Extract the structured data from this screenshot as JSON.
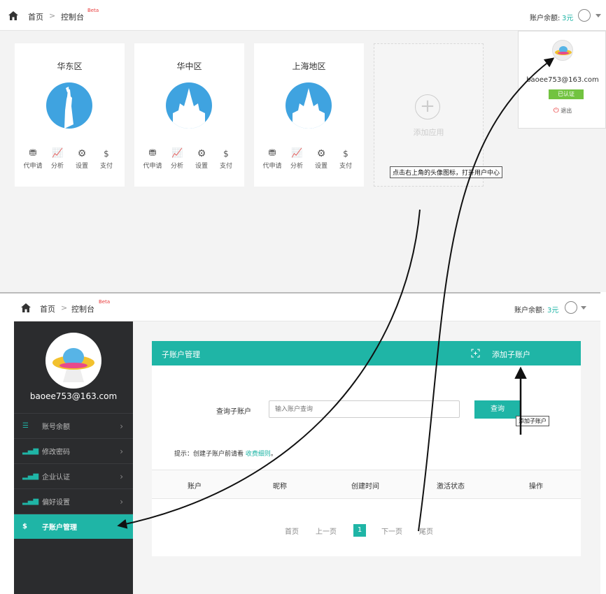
{
  "top": {
    "breadcrumb": {
      "home": "首页",
      "sep": ">",
      "current": "控制台",
      "beta": "Beta"
    },
    "balance": {
      "label": "账户余额:",
      "value": "3元"
    },
    "regions": [
      {
        "title": "华东区",
        "actions": [
          "代申请",
          "分析",
          "设置",
          "支付"
        ]
      },
      {
        "title": "华中区",
        "actions": [
          "代申请",
          "分析",
          "设置",
          "支付"
        ]
      },
      {
        "title": "上海地区",
        "actions": [
          "代申请",
          "分析",
          "设置",
          "支付"
        ]
      }
    ],
    "add_card": {
      "plus": "+",
      "label": "添加应用"
    },
    "tooltip": "点击右上角的头像图标，打开用户中心",
    "user_popup": {
      "email": "baoee753@163.com",
      "badge": "已认证",
      "logout": "退出"
    }
  },
  "bottom": {
    "breadcrumb": {
      "home": "首页",
      "sep": ">",
      "current": "控制台",
      "beta": "Beta"
    },
    "balance": {
      "label": "账户余额:",
      "value": "3元"
    },
    "sidebar": {
      "email": "baoee753@163.com",
      "items": [
        {
          "label": "账号余额",
          "icon": "list-icon"
        },
        {
          "label": "修改密码",
          "icon": "bar-chart-icon"
        },
        {
          "label": "企业认证",
          "icon": "bar-chart-icon"
        },
        {
          "label": "偏好设置",
          "icon": "bar-chart-icon"
        },
        {
          "label": "子账户管理",
          "icon": "money-bag-icon"
        }
      ]
    },
    "panel": {
      "title": "子账户管理",
      "add_label": "添加子账户",
      "query_label": "查询子账户",
      "query_placeholder": "输入账户查询",
      "query_button": "查询",
      "tip_prefix": "提示：创建子账户前请看 ",
      "tip_link": "收费细则",
      "tip_suffix": "。",
      "columns": [
        "账户",
        "昵称",
        "创建时间",
        "激活状态",
        "操作"
      ],
      "pager": {
        "first": "首页",
        "prev": "上一页",
        "current": "1",
        "next": "下一页",
        "last": "尾页"
      }
    },
    "tooltip": "添加子账户"
  },
  "colors": {
    "accent": "#1fb5a6",
    "sidebar": "#2b2c2e",
    "beta": "#e83a3a",
    "verified": "#72c340"
  }
}
